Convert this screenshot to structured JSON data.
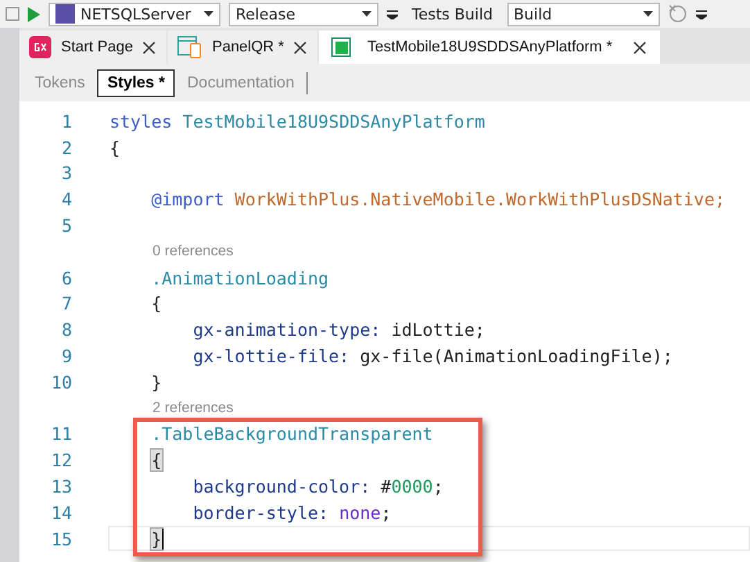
{
  "toolbar": {
    "environment": "NETSQLServer",
    "configuration": "Release",
    "build_label": "Tests Build",
    "build_target": "Build"
  },
  "tabs": [
    {
      "label": "Start Page",
      "selected": false
    },
    {
      "label": "PanelQR *",
      "selected": false
    },
    {
      "label": "TestMobile18U9SDDSAnyPlatform *",
      "selected": true
    }
  ],
  "subtabs": [
    {
      "label": "Tokens",
      "selected": false
    },
    {
      "label": "Styles *",
      "selected": true
    },
    {
      "label": "Documentation",
      "selected": false
    }
  ],
  "editor": {
    "lines": [
      {
        "kind": "top",
        "number": "1",
        "current": false,
        "tokens": [
          {
            "kind": "keyword",
            "text": "styles"
          },
          {
            "kind": "class",
            "text": " TestMobile18U9SDDSAnyPlatform"
          }
        ]
      },
      {
        "kind": "top",
        "number": "2",
        "current": false,
        "tokens": [
          {
            "kind": "plain",
            "text": "{"
          }
        ]
      },
      {
        "kind": "top",
        "number": "3",
        "current": false
      },
      {
        "kind": "rule",
        "number": "4",
        "current": false,
        "tokens": [
          {
            "kind": "keyword",
            "text": "@import"
          },
          {
            "kind": "path",
            "text": " WorkWithPlus.NativeMobile.WorkWithPlusDSNative;"
          }
        ]
      },
      {
        "kind": "top",
        "number": "5",
        "current": false
      },
      {
        "kind": "lens",
        "text": "0 references"
      },
      {
        "kind": "rule",
        "number": "6",
        "current": false,
        "tokens": [
          {
            "kind": "class",
            "text": ".AnimationLoading"
          }
        ]
      },
      {
        "kind": "rule",
        "number": "7",
        "current": false,
        "tokens": [
          {
            "kind": "plain",
            "text": "{"
          }
        ]
      },
      {
        "kind": "decl",
        "number": "8",
        "current": false,
        "tokens": [
          {
            "kind": "property",
            "text": "gx-animation-type:"
          },
          {
            "kind": "plain",
            "text": " idLottie;"
          }
        ]
      },
      {
        "kind": "decl",
        "number": "9",
        "current": false,
        "tokens": [
          {
            "kind": "property",
            "text": "gx-lottie-file:"
          },
          {
            "kind": "plain",
            "text": " gx-file(AnimationLoadingFile);"
          }
        ]
      },
      {
        "kind": "rule",
        "number": "10",
        "current": false,
        "tokens": [
          {
            "kind": "plain",
            "text": "}"
          }
        ]
      },
      {
        "kind": "lens",
        "text": "2 references"
      },
      {
        "kind": "highlight-box",
        "lines": [
          {
            "kind": "rule",
            "number": "11",
            "current": false,
            "tokens": [
              {
                "kind": "class",
                "text": ".TableBackgroundTransparent"
              }
            ]
          },
          {
            "kind": "rule",
            "number": "12",
            "current": false,
            "tokens": [
              {
                "kind": "brace-match",
                "text": "{"
              }
            ]
          },
          {
            "kind": "decl",
            "number": "13",
            "current": false,
            "tokens": [
              {
                "kind": "property",
                "text": "background-color:"
              },
              {
                "kind": "plain",
                "text": " #"
              },
              {
                "kind": "number",
                "text": "0000"
              },
              {
                "kind": "plain",
                "text": ";"
              }
            ]
          },
          {
            "kind": "decl",
            "number": "14",
            "current": false,
            "tokens": [
              {
                "kind": "property",
                "text": "border-style:"
              },
              {
                "kind": "value",
                "text": " none"
              },
              {
                "kind": "plain",
                "text": ";"
              }
            ]
          },
          {
            "kind": "rule",
            "number": "15",
            "current": true,
            "tokens": [
              {
                "kind": "brace-match",
                "text": "}"
              }
            ]
          }
        ]
      }
    ]
  }
}
